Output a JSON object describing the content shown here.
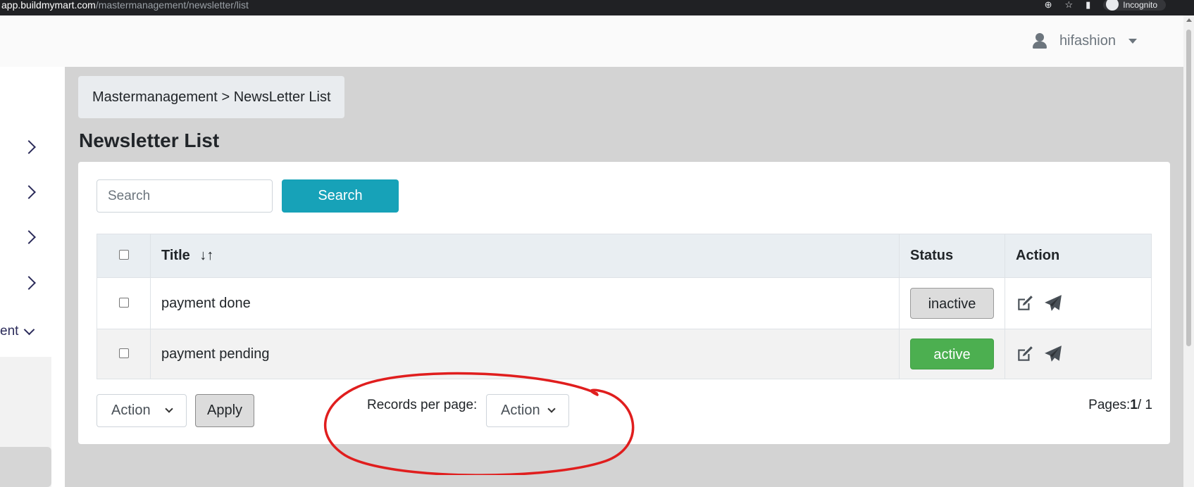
{
  "browser": {
    "url_host": "app.buildmymart.com",
    "url_path": "/mastermanagement/newsletter/list",
    "incognito_label": "Incognito"
  },
  "header": {
    "username": "hifashion"
  },
  "sidebar": {
    "expanded_item_label": "ent"
  },
  "breadcrumb": {
    "parent": "Mastermanagement",
    "separator": ">",
    "current": "NewsLetter List"
  },
  "page": {
    "title": "Newsletter List"
  },
  "search": {
    "placeholder": "Search",
    "button_label": "Search"
  },
  "table": {
    "columns": {
      "title": "Title",
      "sort_arrows": "↓↑",
      "status": "Status",
      "action": "Action"
    },
    "rows": [
      {
        "title": "payment done",
        "status": "inactive"
      },
      {
        "title": "payment pending",
        "status": "active"
      }
    ]
  },
  "bulk": {
    "select_value": "Action",
    "apply_label": "Apply"
  },
  "pagination": {
    "records_label": "Records per page:",
    "records_select_value": "Action",
    "pages_label": "Pages:",
    "current_page": "1",
    "total_pages": "/ 1"
  },
  "colors": {
    "search_button": "#17a2b8",
    "active_badge": "#4caf50",
    "inactive_badge": "#dcdcdc",
    "annotation": "#e01e1e"
  }
}
